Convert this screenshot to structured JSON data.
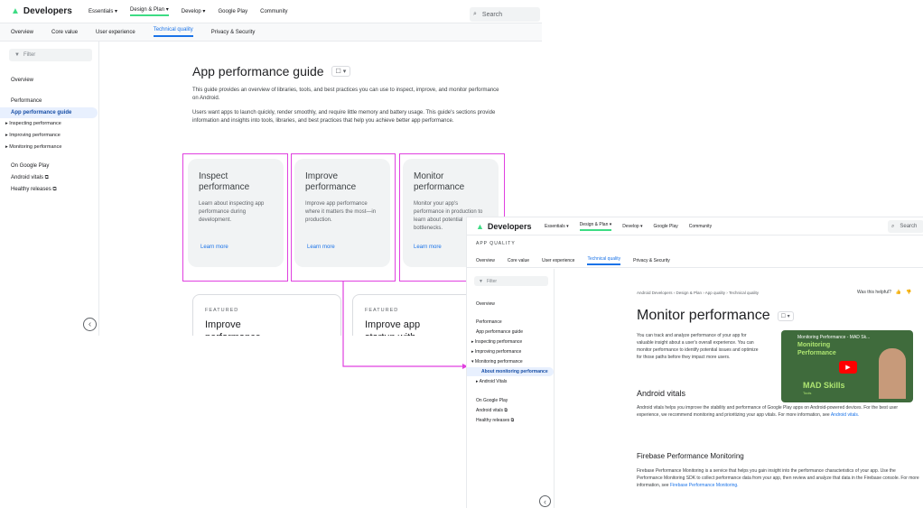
{
  "left": {
    "logo": "Developers",
    "nav": [
      "Essentials ▾",
      "Design & Plan ▾",
      "Develop ▾",
      "Google Play",
      "Community"
    ],
    "search": "Search",
    "subnav": [
      "Overview",
      "Core value",
      "User experience",
      "Technical quality",
      "Privacy & Security"
    ],
    "filter": "Filter",
    "sidebar": [
      "Overview",
      "Performance",
      "App performance guide",
      "▸ Inspecting performance",
      "▸ Improving performance",
      "▸ Monitoring performance",
      "On Google Play",
      "Android vitals ⧉",
      "Healthy releases ⧉"
    ],
    "title": "App performance guide",
    "p1": "This guide provides an overview of libraries, tools, and best practices you can use to inspect, improve, and monitor performance on Android.",
    "p2": "Users want apps to launch quickly, render smoothly, and require little memory and battery usage. This guide's sections provide information and insights into tools, libraries, and best practices that help you achieve better app performance.",
    "cards": [
      {
        "title": "Inspect performance",
        "desc": "Learn about inspecting app performance during development.",
        "link": "Learn more"
      },
      {
        "title": "Improve performance",
        "desc": "Improve app performance where it matters the most—in production.",
        "link": "Learn more"
      },
      {
        "title": "Monitor performance",
        "desc": "Monitor your app's performance in production to learn about potential bottlenecks.",
        "link": "Learn more"
      }
    ],
    "featured": [
      {
        "tag": "FEATURED",
        "title": "Improve performance"
      },
      {
        "tag": "FEATURED",
        "title": "Improve app startup with"
      }
    ],
    "collapse": "‹"
  },
  "right": {
    "logo": "Developers",
    "nav": [
      "Essentials ▾",
      "Design & Plan ▾",
      "Develop ▾",
      "Google Play",
      "Community"
    ],
    "search": "Search",
    "section": "APP QUALITY",
    "subnav": [
      "Overview",
      "Core value",
      "User experience",
      "Technical quality",
      "Privacy & Security"
    ],
    "filter": "Filter",
    "sidebar": [
      "Overview",
      "Performance",
      "App performance guide",
      "▸ Inspecting performance",
      "▸ Improving performance",
      "▾ Monitoring performance",
      "About monitoring performance",
      "▸ Android Vitals",
      "On Google Play",
      "Android vitals ⧉",
      "Healthy releases ⧉"
    ],
    "breadcrumb": "Android Developers  ›  Design & Plan  ›  App quality  ›  Technical quality",
    "helpful": "Was this helpful?",
    "title": "Monitor performance",
    "intro": "You can track and analyze performance of your app for valuable insight about a user's overall experience. You can monitor performance to identify potential issues and optimize for those paths before they impact more users.",
    "video_title": "Monitoring Performance - MAD Sk...",
    "video_brand": "MAD Skills",
    "video_sub": "Tools",
    "video_label": "Monitoring Performance",
    "h2a": "Android vitals",
    "p_vitals": "Android vitals helps you improve the stability and performance of Google Play apps on Android-powered devices. For the best user experience, we recommend monitoring and prioritizing your app vitals. For more information, see",
    "vitals_link": "Android vitals.",
    "h2b": "Firebase Performance Monitoring",
    "p_firebase": "Firebase Performance Monitoring is a service that helps you gain insight into the performance characteristics of your app. Use the Performance Monitoring SDK to collect performance data from your app, then review and analyze that data in the Firebase console. For more information, see",
    "firebase_link": "Firebase Performance Monitoring.",
    "collapse": "‹"
  },
  "colors": {
    "highlight": "#e040e0",
    "link": "#1a73e8",
    "active_bg": "#e8f0fe"
  }
}
